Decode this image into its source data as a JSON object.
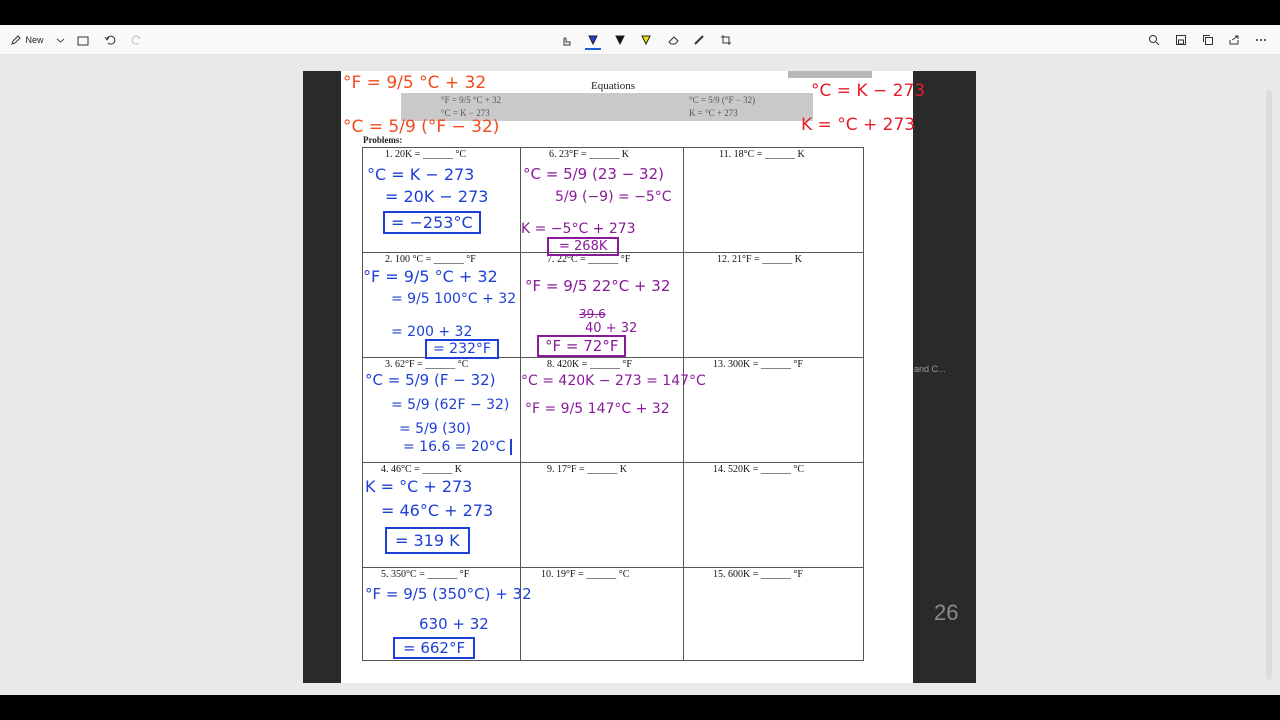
{
  "toolbar": {
    "new_label": "New",
    "icons_left": [
      "pen-icon",
      "chevron-down-icon",
      "open-icon",
      "undo-icon",
      "redo-icon"
    ],
    "icons_center": [
      "touch-write-icon",
      "ballpoint-pen-icon",
      "pen-icon",
      "highlighter-icon",
      "eraser-icon",
      "ruler-icon",
      "crop-icon"
    ],
    "icons_right": [
      "zoom-icon",
      "save-icon",
      "copy-icon",
      "share-icon",
      "more-icon"
    ],
    "accent_color": "#f5d800"
  },
  "worksheet": {
    "equations_title": "Equations",
    "eq_row1_left": "°F = 9/5 °C + 32",
    "eq_row1_right": "°C = 5/9 (°F − 32)",
    "eq_row2_left": "°C = K − 273",
    "eq_row2_right": "K = °C + 273",
    "problems_label": "Problems:",
    "problems": [
      {
        "num": "1.",
        "text": "20K = ______ °C"
      },
      {
        "num": "2.",
        "text": "100 °C = ______ °F"
      },
      {
        "num": "3.",
        "text": "62°F = ______ °C"
      },
      {
        "num": "4.",
        "text": "46°C = ______ K"
      },
      {
        "num": "5.",
        "text": "350°C = ______ °F"
      },
      {
        "num": "6.",
        "text": "23°F = ______ K"
      },
      {
        "num": "7.",
        "text": "22°C = ______ °F"
      },
      {
        "num": "8.",
        "text": "420K = ______ °F"
      },
      {
        "num": "9.",
        "text": "17°F = ______ K"
      },
      {
        "num": "10.",
        "text": "19°F = ______ °C"
      },
      {
        "num": "11.",
        "text": "18°C = ______ K"
      },
      {
        "num": "12.",
        "text": "21°F = ______ K"
      },
      {
        "num": "13.",
        "text": "300K = ______ °F"
      },
      {
        "num": "14.",
        "text": "520K = ______ °C"
      },
      {
        "num": "15.",
        "text": "600K = ______ °F"
      }
    ]
  },
  "annotations": {
    "orange_f": "°F = 9/5 °C + 32",
    "orange_c": "°C = 5/9 (°F − 32)",
    "red_c": "°C = K − 273",
    "red_k": "K = °C + 273",
    "p1_l1": "°C = K − 273",
    "p1_l2": "= 20K − 273",
    "p1_l3": "= −253°C",
    "p2_l1": "°F = 9/5 °C + 32",
    "p2_l2": "= 9/5 100°C + 32",
    "p2_l3": "= 200 + 32",
    "p2_l4": "= 232°F",
    "p3_l1": "°C = 5/9 (F − 32)",
    "p3_l2": "= 5/9 (62F − 32)",
    "p3_l3": "= 5/9 (30)",
    "p3_l4": "= 16.6 = 20°C",
    "p4_l1": "K = °C + 273",
    "p4_l2": "= 46°C + 273",
    "p4_l3": "= 319 K",
    "p5_l1": "°F = 9/5 (350°C) + 32",
    "p5_l2": "630 + 32",
    "p5_l3": "= 662°F",
    "p6_l1": "°C = 5/9 (23 − 32)",
    "p6_l2": "5/9 (−9) = −5°C",
    "p6_l3": "K = −5°C + 273",
    "p6_l4": "= 268K",
    "p7_l1": "°F = 9/5 22°C + 32",
    "p7_l2": "39.6",
    "p7_l3": "40 + 32",
    "p7_l4": "°F = 72°F",
    "p8_l1": "°C = 420K − 273 = 147°C",
    "p8_l2": "°F = 9/5 147°C + 32",
    "ink_blue": "#1e3fd6",
    "ink_purple": "#8a1a9a",
    "ink_orange": "#f24a1c",
    "ink_red": "#e81c2a"
  },
  "background_ghost": {
    "text1": "and C...",
    "number": "26"
  }
}
